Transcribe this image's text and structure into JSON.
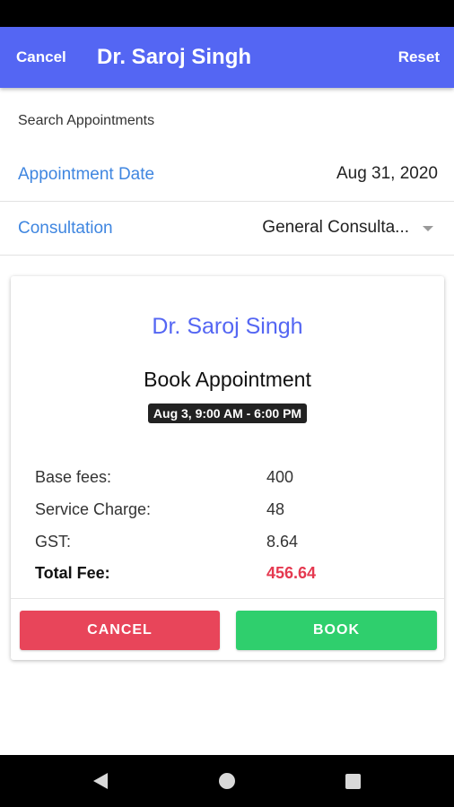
{
  "header": {
    "cancel_label": "Cancel",
    "title": "Dr. Saroj Singh",
    "reset_label": "Reset"
  },
  "search": {
    "label": "Search Appointments",
    "appointment_date_label": "Appointment Date",
    "appointment_date_value": "Aug 31, 2020",
    "consultation_label": "Consultation",
    "consultation_value": "General Consulta..."
  },
  "card": {
    "doctor_name": "Dr. Saroj Singh",
    "heading": "Book Appointment",
    "slot": "Aug 3, 9:00 AM - 6:00 PM",
    "fees": [
      {
        "label": "Base fees:",
        "value": "400"
      },
      {
        "label": "Service Charge:",
        "value": "48"
      },
      {
        "label": "GST:",
        "value": "8.64"
      },
      {
        "label": "Total Fee:",
        "value": "456.64"
      }
    ],
    "cancel_button": "CANCEL",
    "book_button": "BOOK"
  },
  "colors": {
    "header": "#5466f3",
    "label_blue": "#3f86e0",
    "total_red": "#e53950",
    "cancel_red": "#e8455a",
    "book_green": "#2fcf6d"
  },
  "icons": {
    "dropdown": "chevron-down-icon",
    "nav_back": "back-icon",
    "nav_home": "home-icon",
    "nav_recent": "recent-apps-icon"
  }
}
